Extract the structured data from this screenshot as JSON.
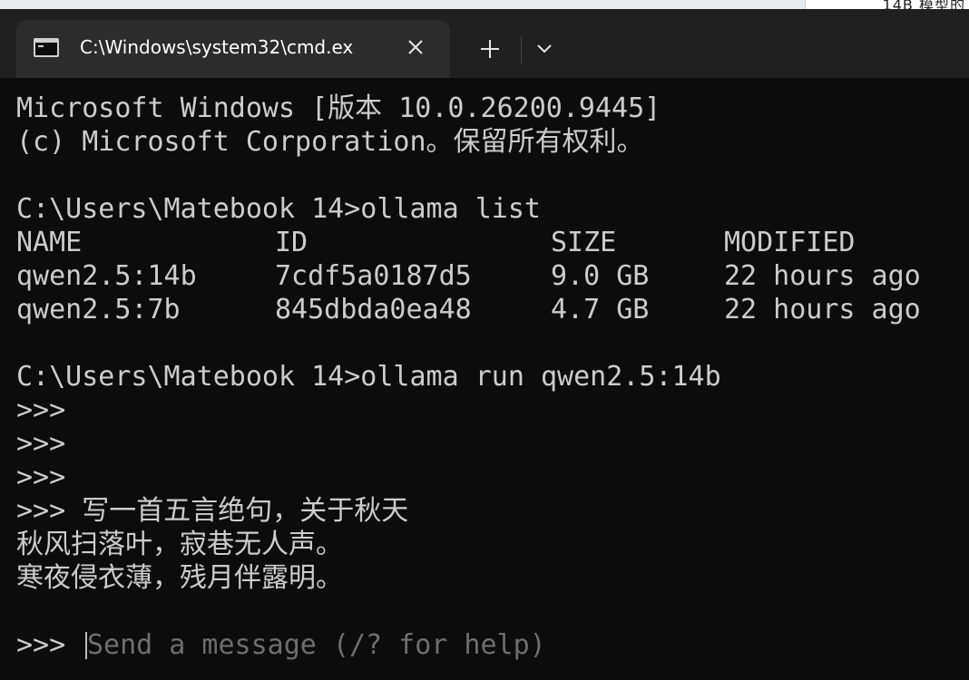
{
  "background_window": {
    "text": "14B 模型的"
  },
  "tab": {
    "title": "C:\\Windows\\system32\\cmd.ex",
    "icon": "cmd-terminal-icon",
    "close_icon": "close-icon"
  },
  "toolbar": {
    "new_tab_icon": "plus-icon",
    "dropdown_icon": "chevron-down-icon"
  },
  "colors": {
    "terminal_bg": "#0c0c0c",
    "text": "#cccccc",
    "titlebar_bg": "#202020",
    "tab_bg": "#2c2c2c",
    "placeholder": "#6e6e6e"
  },
  "terminal": {
    "header_line1": "Microsoft Windows [版本 10.0.26200.9445]",
    "header_line2": "(c) Microsoft Corporation。保留所有权利。",
    "cmd1": "C:\\Users\\Matebook 14>ollama list",
    "table": {
      "headers": [
        "NAME",
        "ID",
        "SIZE",
        "MODIFIED"
      ],
      "rows": [
        [
          "qwen2.5:14b",
          "7cdf5a0187d5",
          "9.0 GB",
          "22 hours ago"
        ],
        [
          "qwen2.5:7b",
          "845dbda0ea48",
          "4.7 GB",
          "22 hours ago"
        ]
      ]
    },
    "cmd2": "C:\\Users\\Matebook 14>ollama run qwen2.5:14b",
    "empty_prompts": [
      ">>>",
      ">>>",
      ">>>"
    ],
    "user_prompt": ">>> 写一首五言绝句，关于秋天",
    "poem_line1": "秋风扫落叶，寂巷无人声。",
    "poem_line2": "寒夜侵衣薄，残月伴露明。",
    "input_prompt": ">>>",
    "input_placeholder": "Send a message (/? for help)"
  }
}
